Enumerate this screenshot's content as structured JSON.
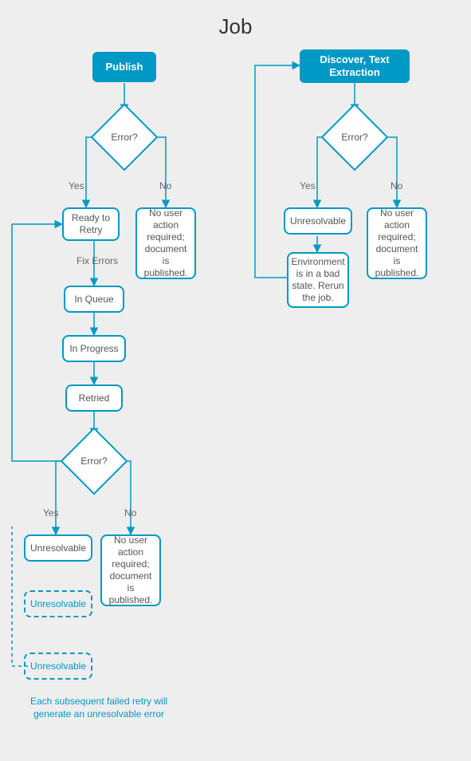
{
  "title": "Job",
  "left": {
    "start": "Publish",
    "decision1": "Error?",
    "yes1": "Yes",
    "no1": "No",
    "readyRetry": "Ready to Retry",
    "noAction1": "No user action required; document is published.",
    "fixErrors": "Fix Errors",
    "inQueue": "In Queue",
    "inProgress": "In Progress",
    "retried": "Retried",
    "decision2": "Error?",
    "yes2": "Yes",
    "no2": "No",
    "unresolvable1": "Unresolvable",
    "noAction2": "No user action required; document is published.",
    "unresolvable2": "Unresolvable",
    "unresolvable3": "Unresolvable",
    "footnote": "Each subsequent failed retry will generate an unresolvable error"
  },
  "right": {
    "start": "Discover, Text Extraction",
    "decision": "Error?",
    "yes": "Yes",
    "no": "No",
    "unresolvable": "Unresolvable",
    "noAction": "No user action required; document is published.",
    "rerun": "Environment is in a bad state. Rerun the job."
  }
}
